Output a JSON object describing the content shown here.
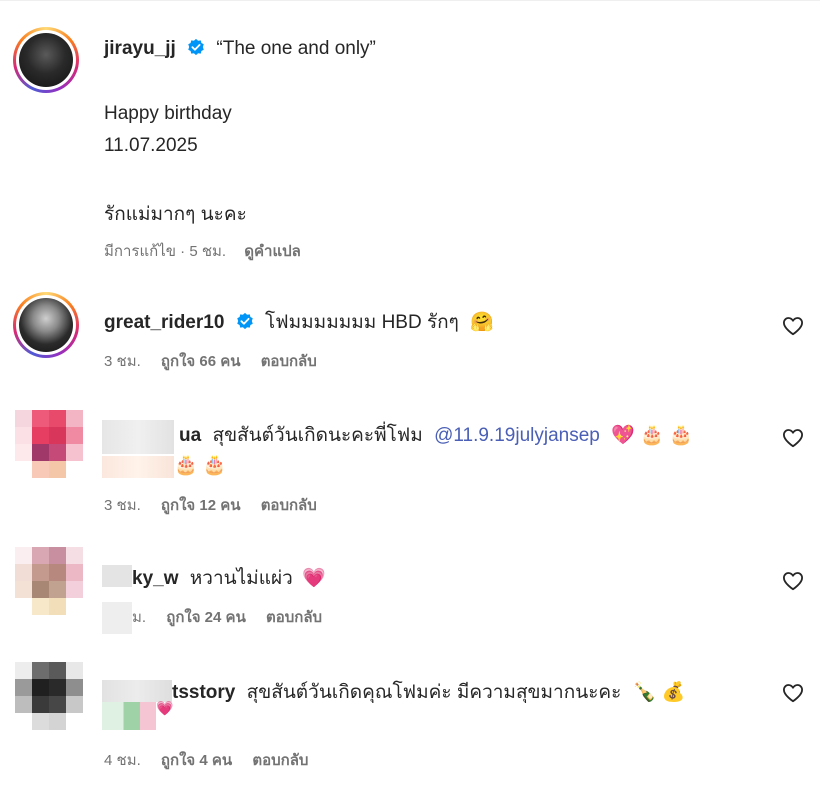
{
  "post": {
    "username": "jirayu_jj",
    "caption_quote": "“The one and only”",
    "line1": "Happy birthday",
    "line2": "11.07.2025",
    "line3": "รักแม่มากๆ นะคะ",
    "meta_edited": "มีการแก้ไข · 5 ชม.",
    "meta_translate": "ดูคำแปล"
  },
  "comments": [
    {
      "username": "great_rider10",
      "text": "โฟมมมมมมม HBD รักๆ",
      "emoji": "🤗",
      "time": "3 ชม.",
      "likes": "ถูกใจ 66 คน",
      "reply": "ตอบกลับ"
    },
    {
      "username_visible": "ua",
      "text": "สุขสันต์วันเกิดนะคะพี่โฟม",
      "mention": "@11.9.19julyjansep",
      "emoji_line1": "💖 🎂 🎂",
      "emoji_line2": "🎂 🎂",
      "time": "3 ชม.",
      "likes": "ถูกใจ 12 คน",
      "reply": "ตอบกลับ"
    },
    {
      "username_visible": "ky_w",
      "text": "หวานไม่แผ่ว",
      "emoji": "💗",
      "time": "ม.",
      "likes": "ถูกใจ 24 คน",
      "reply": "ตอบกลับ"
    },
    {
      "username_visible": "tsstory",
      "text": "สุขสันต์วันเกิดคุณโฟมค่ะ มีความสุขมากนะคะ",
      "emoji": "🍾 💰",
      "emoji_line2": "💗",
      "time": "4 ชม.",
      "likes": "ถูกใจ 4 คน",
      "reply": "ตอบกลับ"
    }
  ],
  "colors": {
    "verified": "#0095f6",
    "mention": "#4a5fb5",
    "meta": "#737373"
  },
  "icons": {
    "like": "heart-outline-icon",
    "verified": "verified-badge-icon"
  }
}
